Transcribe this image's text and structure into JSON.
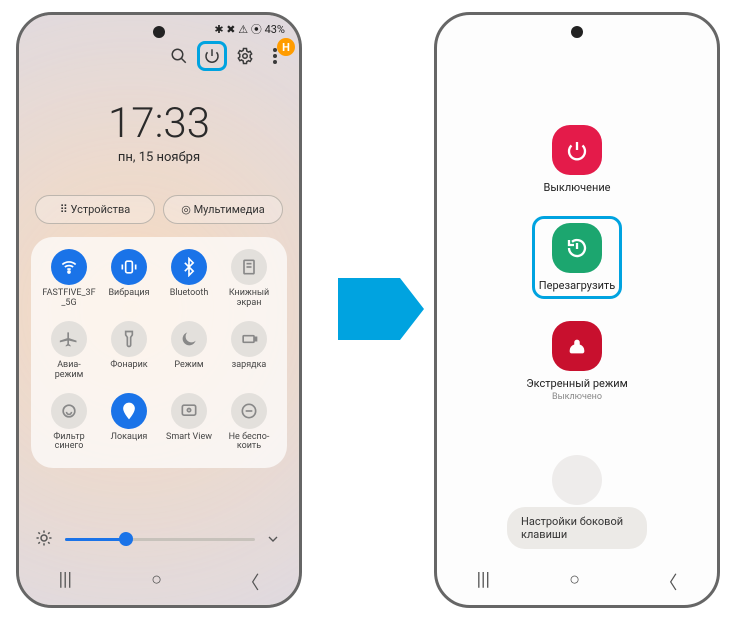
{
  "status_bar": {
    "indicators": "✱ ✖ ⚠ ⦿ 43%",
    "avatar_letter": "H"
  },
  "clock": {
    "time": "17:33",
    "date": "пн, 15 ноября"
  },
  "chips": {
    "devices": "⠿  Устройства",
    "media": "◎  Мультимедиа"
  },
  "tiles": [
    {
      "label": "FASTFIVE_3F\n_5G",
      "icon": "wifi",
      "on": true
    },
    {
      "label": "Вибрация",
      "icon": "vibrate",
      "on": true
    },
    {
      "label": "Bluetooth",
      "icon": "bluetooth",
      "on": true
    },
    {
      "label": "Книжный\nэкран",
      "icon": "book",
      "on": false
    },
    {
      "label": "Авиа-\nрежим",
      "icon": "plane",
      "on": false
    },
    {
      "label": "Фонарик",
      "icon": "torch",
      "on": false
    },
    {
      "label": "Режим",
      "icon": "moon",
      "on": false
    },
    {
      "label": "зарядка",
      "icon": "battery",
      "on": false
    },
    {
      "label": "Фильтр\nсинего",
      "icon": "eye",
      "on": false
    },
    {
      "label": "Локация",
      "icon": "location",
      "on": true
    },
    {
      "label": "Smart View",
      "icon": "cast",
      "on": false
    },
    {
      "label": "Не беспо-\nкоить",
      "icon": "dnd",
      "on": false
    }
  ],
  "power_menu": {
    "off": "Выключение",
    "restart": "Перезагрузить",
    "emergency": "Экстренный режим",
    "emergency_sub": "Выключено",
    "side_key": "Настройки боковой клавиши"
  }
}
